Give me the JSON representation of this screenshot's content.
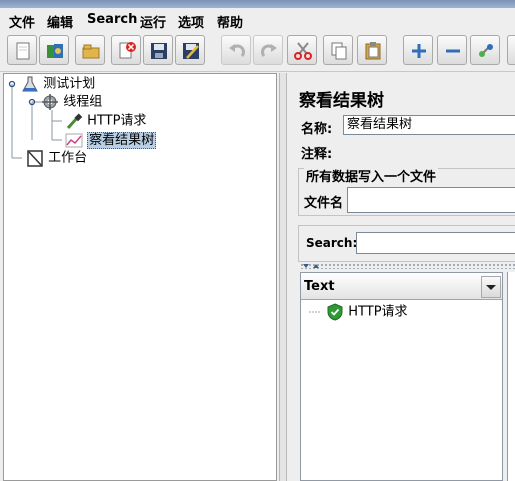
{
  "menu": [
    "文件",
    "编辑",
    "Search",
    "运行",
    "选项",
    "帮助"
  ],
  "toolbar": {
    "buttons": [
      "new-icon",
      "templates-icon",
      "open-icon",
      "close-icon",
      "save-icon",
      "save-as-icon",
      "undo-icon",
      "redo-icon",
      "cut-icon",
      "copy-icon",
      "paste-icon",
      "expand-icon",
      "collapse-icon",
      "toggle-icon"
    ]
  },
  "tree": {
    "test_plan": "测试计划",
    "thread_group": "线程组",
    "http_request": "HTTP请求",
    "result_tree": "察看结果树",
    "workbench": "工作台"
  },
  "panel": {
    "title": "察看结果树",
    "name_label": "名称:",
    "name_value": "察看结果树",
    "comment_label": "注释:",
    "group_title": "所有数据写入一个文件",
    "filename_label": "文件名",
    "search_label": "Search:"
  },
  "results": {
    "column": "Text",
    "items": [
      "HTTP请求"
    ]
  },
  "colors": {
    "selection": "#b8cfe5",
    "success": "#2e9a35"
  }
}
